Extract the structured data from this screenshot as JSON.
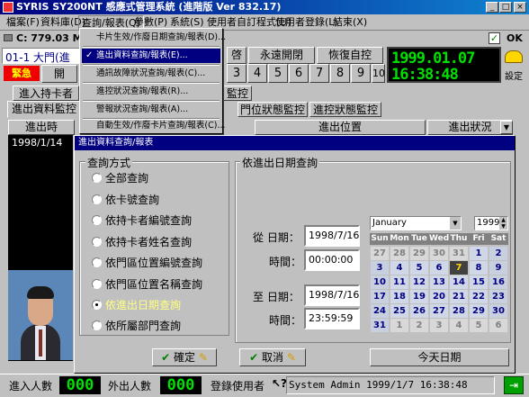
{
  "window": {
    "title": "SYRIS SY200NT 感應式管理系統 (進階版 Ver 832.17)"
  },
  "menu": [
    "檔案(F)",
    "資料庫(D)",
    "查詢/報表(Q)",
    "參數(P)",
    "系統(S)",
    "使用者自訂程式(U)",
    "使用者登錄(L)",
    "結束(X)"
  ],
  "toolbar": {
    "drive": "C: 779.03 MB",
    "ok": "OK"
  },
  "door": {
    "label": "01-1 大門(進",
    "alarm": "緊急",
    "open": "開",
    "partial": "啓",
    "perm_open": "永遠開閉",
    "restore": "恢復自控",
    "settings": "設定"
  },
  "numbers": [
    "3",
    "4",
    "5",
    "6",
    "7",
    "8",
    "9",
    "10"
  ],
  "clock": {
    "date": "1999.01.07",
    "time": "16:38:48"
  },
  "tabs_row1": [
    "進入持卡者",
    "監控"
  ],
  "tabs_row2": [
    "進出資料監控",
    "門位狀態監控",
    "進控狀態監控"
  ],
  "table": {
    "headers": [
      "進出時",
      "進出位置",
      "進出狀況"
    ],
    "first_cell": "1998/1/14"
  },
  "dropdown": {
    "items": [
      "卡片生效/作廢日期查詢/報表(D)...",
      "進出資料查詢/報表(E)...",
      "通訊故障狀況查詢/報表(C)...",
      "進控狀況查詢/報表(R)...",
      "警報狀況查詢/報表(A)...",
      "自動生效/作廢卡片查詢/報表(C)..."
    ],
    "checked_index": 1
  },
  "dialog": {
    "title": "進出資料查詢/報表",
    "group_mode": "查詢方式",
    "options": [
      "全部查詢",
      "依卡號查詢",
      "依持卡者編號查詢",
      "依持卡者姓名查詢",
      "依門區位置編號查詢",
      "依門區位置名稱查詢",
      "依進出日期查詢",
      "依所屬部門查詢"
    ],
    "selected_index": 6,
    "group_date": "依進出日期查詢",
    "from_date_label": "從 日期：",
    "from_date": "1998/7/16",
    "from_time_label": "時間：",
    "from_time": "00:00:00",
    "to_date_label": "至 日期：",
    "to_date": "1998/7/16",
    "to_time_label": "時間：",
    "to_time": "23:59:59",
    "ok_button": "確定",
    "cancel_button": "取消",
    "today_button": "今天日期"
  },
  "calendar": {
    "month": "January",
    "year": "1999",
    "weekdays": [
      "Sun",
      "Mon",
      "Tue",
      "Wed",
      "Thu",
      "Fri",
      "Sat"
    ],
    "days": [
      "27",
      "28",
      "29",
      "30",
      "31",
      "1",
      "2",
      "3",
      "4",
      "5",
      "6",
      "7",
      "8",
      "9",
      "10",
      "11",
      "12",
      "13",
      "14",
      "15",
      "16",
      "17",
      "18",
      "19",
      "20",
      "21",
      "22",
      "23",
      "24",
      "25",
      "26",
      "27",
      "28",
      "29",
      "30",
      "31",
      "1",
      "2",
      "3",
      "4",
      "5",
      "6"
    ],
    "selected": "7"
  },
  "status": {
    "in_label": "進入人數",
    "in_value": "000",
    "out_label": "外出人數",
    "out_value": "000",
    "user_label": "登錄使用者",
    "user_info": "System Admin 1999/1/7 16:38:48"
  }
}
